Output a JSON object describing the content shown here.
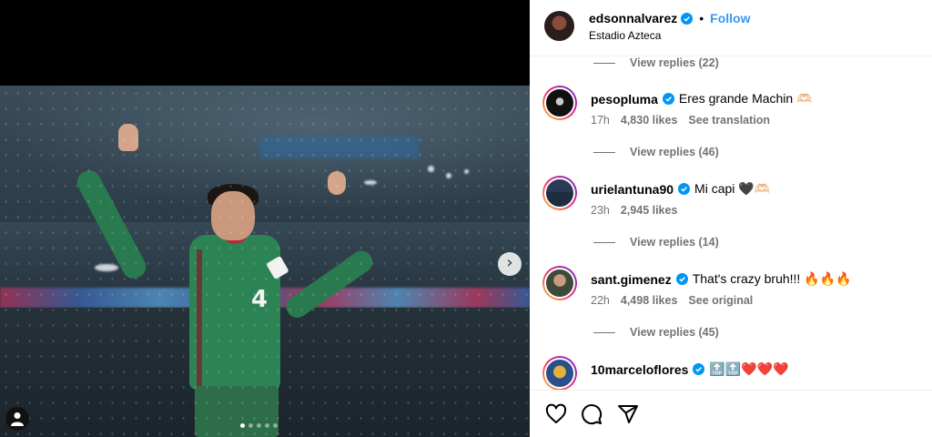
{
  "header": {
    "username": "edsonnalvarez",
    "follow_separator": "•",
    "follow_label": "Follow",
    "location": "Estadio Azteca"
  },
  "media": {
    "jersey_number": "4",
    "carousel_dots": 5,
    "active_dot": 1,
    "next_icon": "chevron-right-icon",
    "tag_icon": "person-tag-icon"
  },
  "comments": {
    "top_replies": "View replies (22)",
    "items": [
      {
        "username": "pesopluma",
        "text": "Eres grande Machin 🫶🏻",
        "time": "17h",
        "likes": "4,830 likes",
        "action": "See translation",
        "replies": "View replies (46)"
      },
      {
        "username": "urielantuna90",
        "text": "Mi capi 🖤🫶🏻",
        "time": "23h",
        "likes": "2,945 likes",
        "action": "",
        "replies": "View replies (14)"
      },
      {
        "username": "sant.gimenez",
        "text": "That's crazy bruh!!! 🔥🔥🔥",
        "time": "22h",
        "likes": "4,498 likes",
        "action": "See original",
        "replies": "View replies (45)"
      },
      {
        "username": "10marceloflores",
        "text": "🔝🔝❤️❤️❤️"
      }
    ]
  },
  "actions": {
    "like_icon": "heart-icon",
    "comment_icon": "comment-icon",
    "share_icon": "send-icon"
  },
  "colors": {
    "link_blue": "#3897f0",
    "verified_blue": "#0095f6",
    "meta_gray": "#737373"
  }
}
